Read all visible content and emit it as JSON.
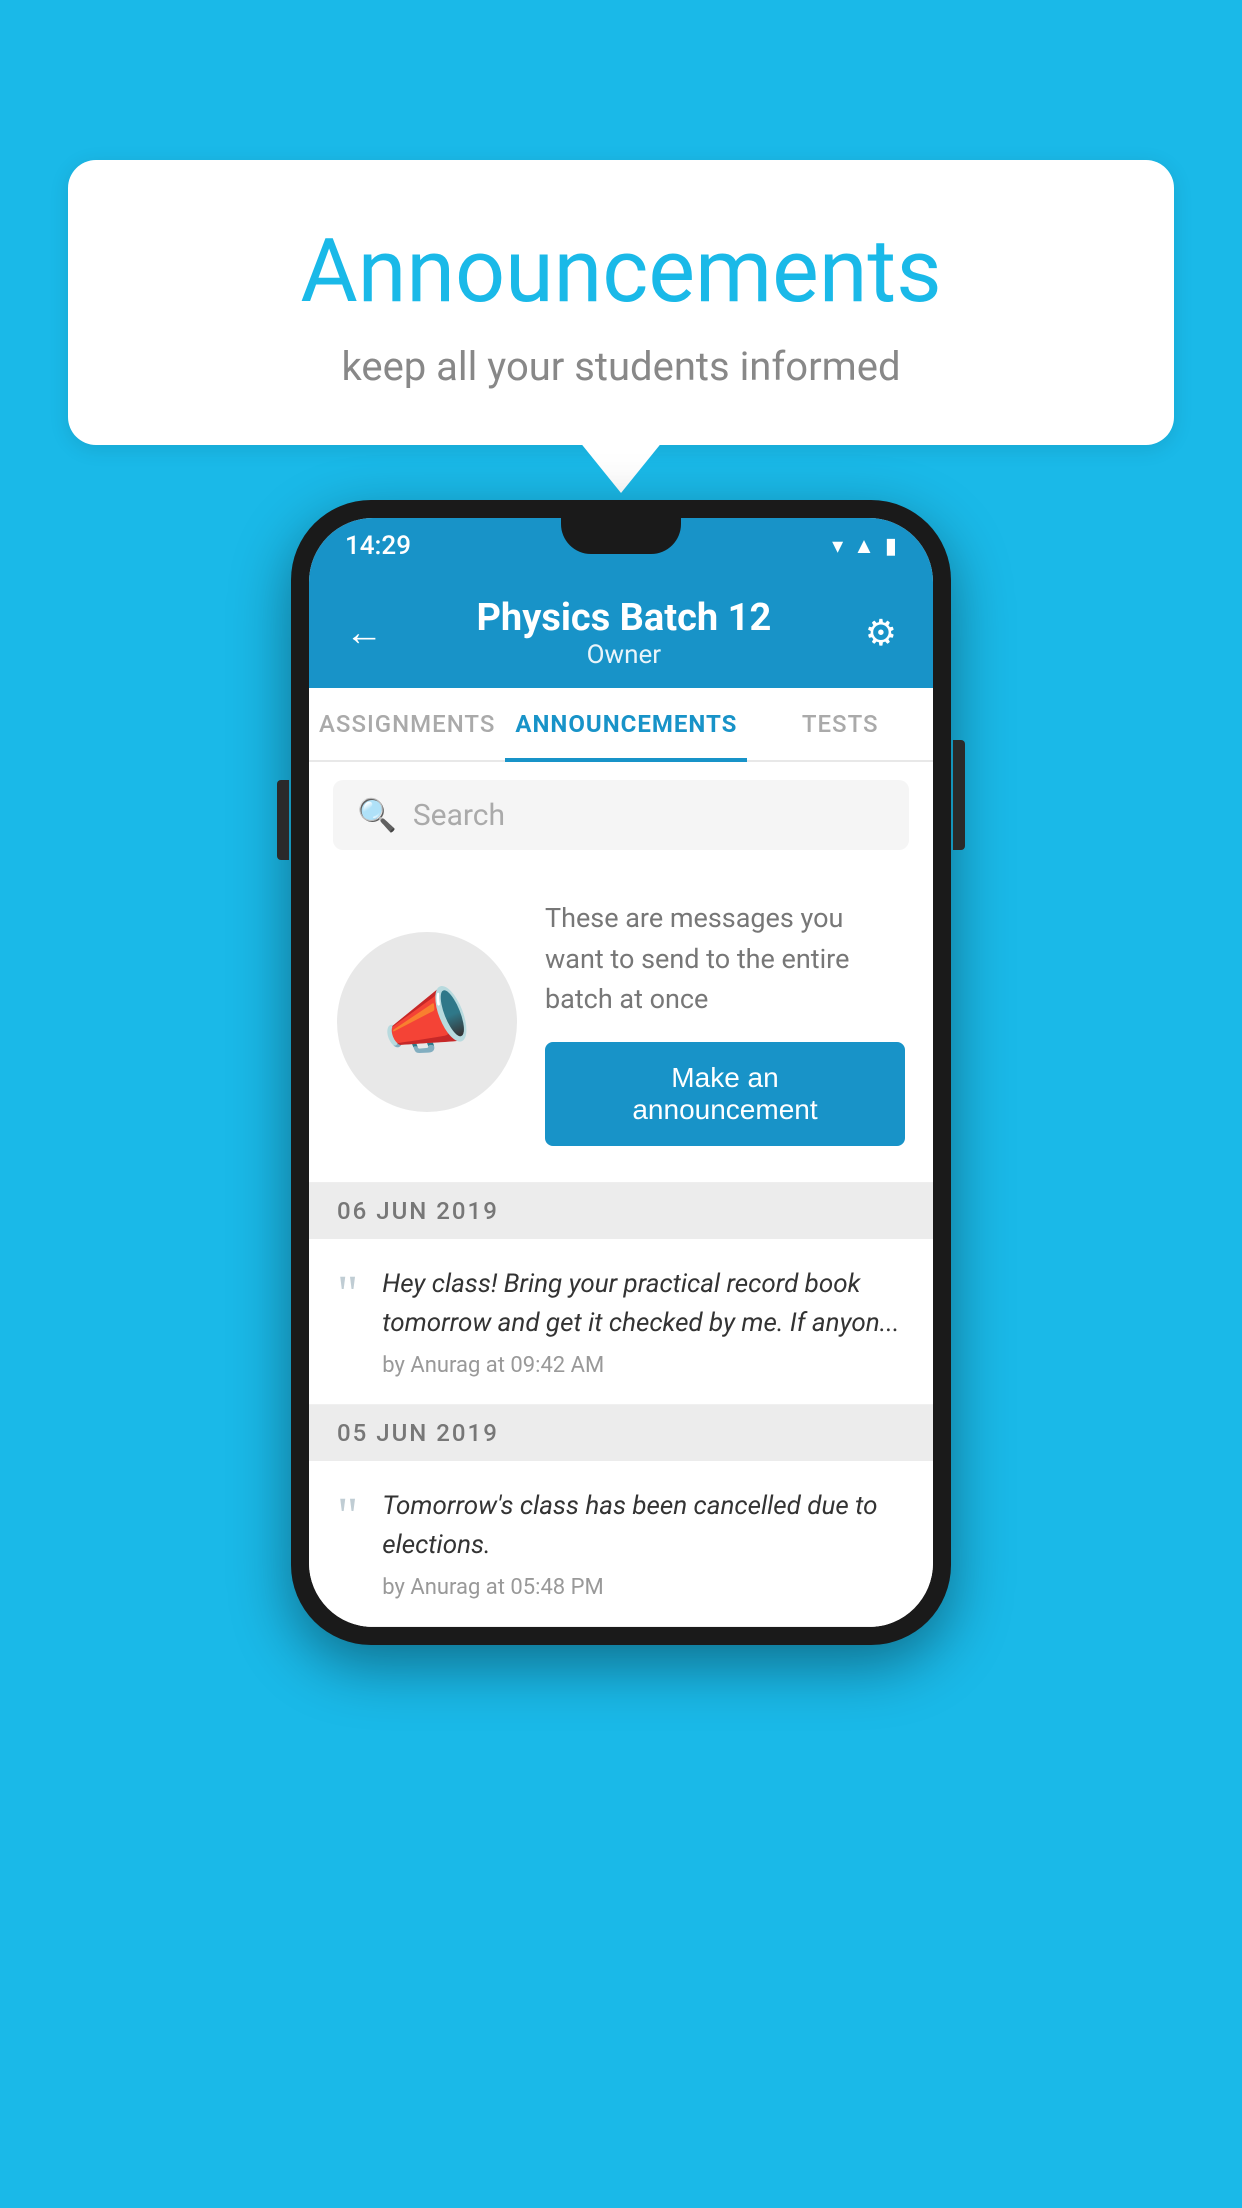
{
  "background_color": "#1ab9e8",
  "speech_bubble": {
    "title": "Announcements",
    "subtitle": "keep all your students informed"
  },
  "phone": {
    "status_bar": {
      "time": "14:29"
    },
    "header": {
      "title": "Physics Batch 12",
      "subtitle": "Owner",
      "back_label": "←",
      "gear_label": "⚙"
    },
    "tabs": [
      {
        "label": "ASSIGNMENTS",
        "active": false
      },
      {
        "label": "ANNOUNCEMENTS",
        "active": true
      },
      {
        "label": "TESTS",
        "active": false
      }
    ],
    "search": {
      "placeholder": "Search"
    },
    "promo": {
      "description": "These are messages you want to send to the entire batch at once",
      "button_label": "Make an announcement"
    },
    "announcements": [
      {
        "date": "06  JUN  2019",
        "text": "Hey class! Bring your practical record book tomorrow and get it checked by me. If anyon...",
        "meta": "by Anurag at 09:42 AM"
      },
      {
        "date": "05  JUN  2019",
        "text": "Tomorrow's class has been cancelled due to elections.",
        "meta": "by Anurag at 05:48 PM"
      }
    ]
  }
}
